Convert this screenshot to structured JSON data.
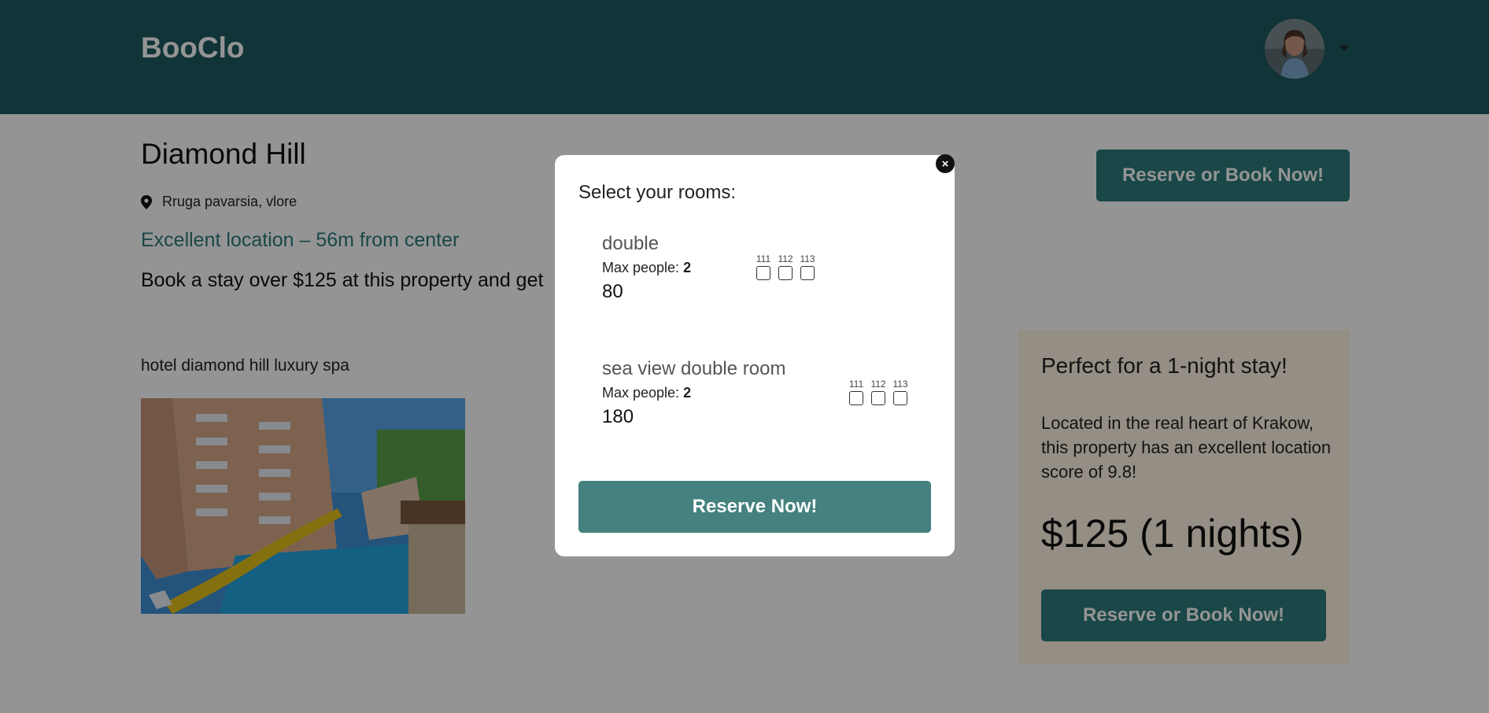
{
  "header": {
    "brand": "BooClo",
    "avatar_icon": "user-avatar",
    "menu_icon": "caret-down-icon"
  },
  "hotel": {
    "name": "Diamond Hill",
    "address": "Rruga pavarsia, vlore",
    "location_note": "Excellent location – 56m from center",
    "promo": "Book a stay over $125 at this property and get",
    "subtitle": "hotel diamond hill luxury spa",
    "book_button": "Reserve or Book Now!"
  },
  "side_card": {
    "title": "Perfect for a 1-night stay!",
    "description": "Located in the real heart of Krakow, this property has an excellent location score of 9.8!",
    "price": "$125",
    "nights": "(1 nights)",
    "button": "Reserve or Book Now!"
  },
  "modal": {
    "title": "Select your rooms:",
    "close_symbol": "×",
    "reserve_button": "Reserve Now!",
    "max_people_label": "Max people:",
    "rooms": [
      {
        "name": "double",
        "max_people": "2",
        "price": "80",
        "room_numbers": [
          "111",
          "112",
          "113"
        ]
      },
      {
        "name": "sea view double room",
        "max_people": "2",
        "price": "180",
        "room_numbers": [
          "111",
          "112",
          "113"
        ]
      }
    ]
  },
  "colors": {
    "navbar": "#1c5a60",
    "primary_button": "#2d7b7b",
    "modal_button": "#44817f",
    "side_card_bg": "#fff5e3",
    "accent_text": "#2d7a7a"
  }
}
